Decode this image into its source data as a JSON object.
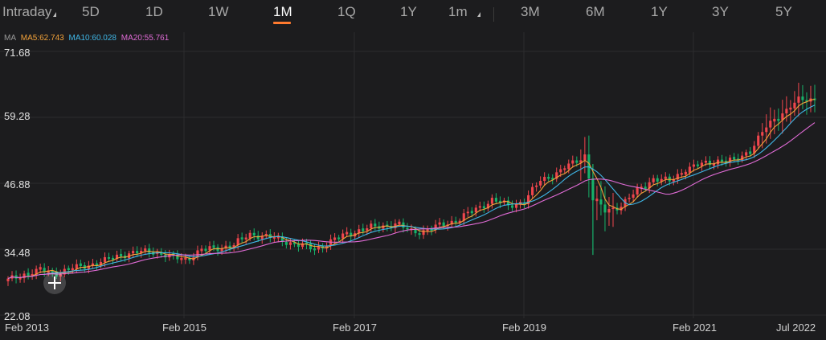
{
  "tabs": [
    {
      "label": "Intraday",
      "dropdown": true
    },
    {
      "label": "5D"
    },
    {
      "label": "1D"
    },
    {
      "label": "1W"
    },
    {
      "label": "1M",
      "active": true
    },
    {
      "label": "1Q"
    },
    {
      "label": "1Y"
    },
    {
      "label": "1m",
      "dropdown": true
    },
    {
      "label": "3M"
    },
    {
      "label": "6M"
    },
    {
      "label": "1Y"
    },
    {
      "label": "3Y"
    },
    {
      "label": "5Y"
    }
  ],
  "ma_legend": {
    "label": "MA",
    "ma5": "MA5:62.743",
    "ma10": "MA10:60.028",
    "ma20": "MA20:55.761"
  },
  "colors": {
    "up": "#f0464d",
    "down": "#17b26a",
    "ma5": "#f2a23a",
    "ma10": "#3fb6e6",
    "ma20": "#e06bd6",
    "grid": "#2c2c2e",
    "accent": "#ff7a2f"
  },
  "chart_data": {
    "type": "candlestick",
    "interval": "1M",
    "y_ticks": [
      "71.68",
      "59.28",
      "46.88",
      "34.48",
      "22.08"
    ],
    "ylim": [
      22.08,
      71.68
    ],
    "x_ticks": [
      "Feb 2013",
      "Feb 2015",
      "Feb 2017",
      "Feb 2019",
      "Feb 2021",
      "Jul 2022"
    ],
    "series": [
      {
        "name": "MA5",
        "value": 62.743
      },
      {
        "name": "MA10",
        "value": 60.028
      },
      {
        "name": "MA20",
        "value": 55.761
      }
    ],
    "anchors": [
      [
        0,
        28.6
      ],
      [
        4,
        29.8
      ],
      [
        8,
        30.4
      ],
      [
        12,
        30.0
      ],
      [
        16,
        30.8
      ],
      [
        20,
        31.6
      ],
      [
        24,
        32.2
      ],
      [
        28,
        33.5
      ],
      [
        32,
        33.8
      ],
      [
        36,
        34.2
      ],
      [
        40,
        33.0
      ],
      [
        44,
        32.6
      ],
      [
        48,
        34.2
      ],
      [
        52,
        34.8
      ],
      [
        56,
        35.2
      ],
      [
        60,
        37.4
      ],
      [
        64,
        36.8
      ],
      [
        68,
        36.2
      ],
      [
        72,
        35.2
      ],
      [
        76,
        34.6
      ],
      [
        80,
        35.8
      ],
      [
        84,
        37.4
      ],
      [
        88,
        38.2
      ],
      [
        92,
        38.8
      ],
      [
        96,
        39.2
      ],
      [
        100,
        37.8
      ],
      [
        104,
        38.0
      ],
      [
        108,
        39.2
      ],
      [
        112,
        40.2
      ],
      [
        116,
        42.0
      ],
      [
        120,
        43.8
      ],
      [
        124,
        42.6
      ],
      [
        128,
        43.5
      ],
      [
        132,
        47.4
      ],
      [
        136,
        48.8
      ],
      [
        140,
        50.6
      ],
      [
        143,
        52.2
      ],
      [
        145,
        44.0
      ],
      [
        148,
        41.6
      ],
      [
        152,
        42.8
      ],
      [
        156,
        45.4
      ],
      [
        160,
        47.8
      ],
      [
        164,
        47.2
      ],
      [
        168,
        49.6
      ],
      [
        172,
        50.4
      ],
      [
        176,
        51.2
      ],
      [
        180,
        51.0
      ],
      [
        184,
        53.2
      ],
      [
        188,
        57.4
      ],
      [
        192,
        60.2
      ],
      [
        196,
        62.4
      ],
      [
        200,
        62.8
      ]
    ]
  }
}
